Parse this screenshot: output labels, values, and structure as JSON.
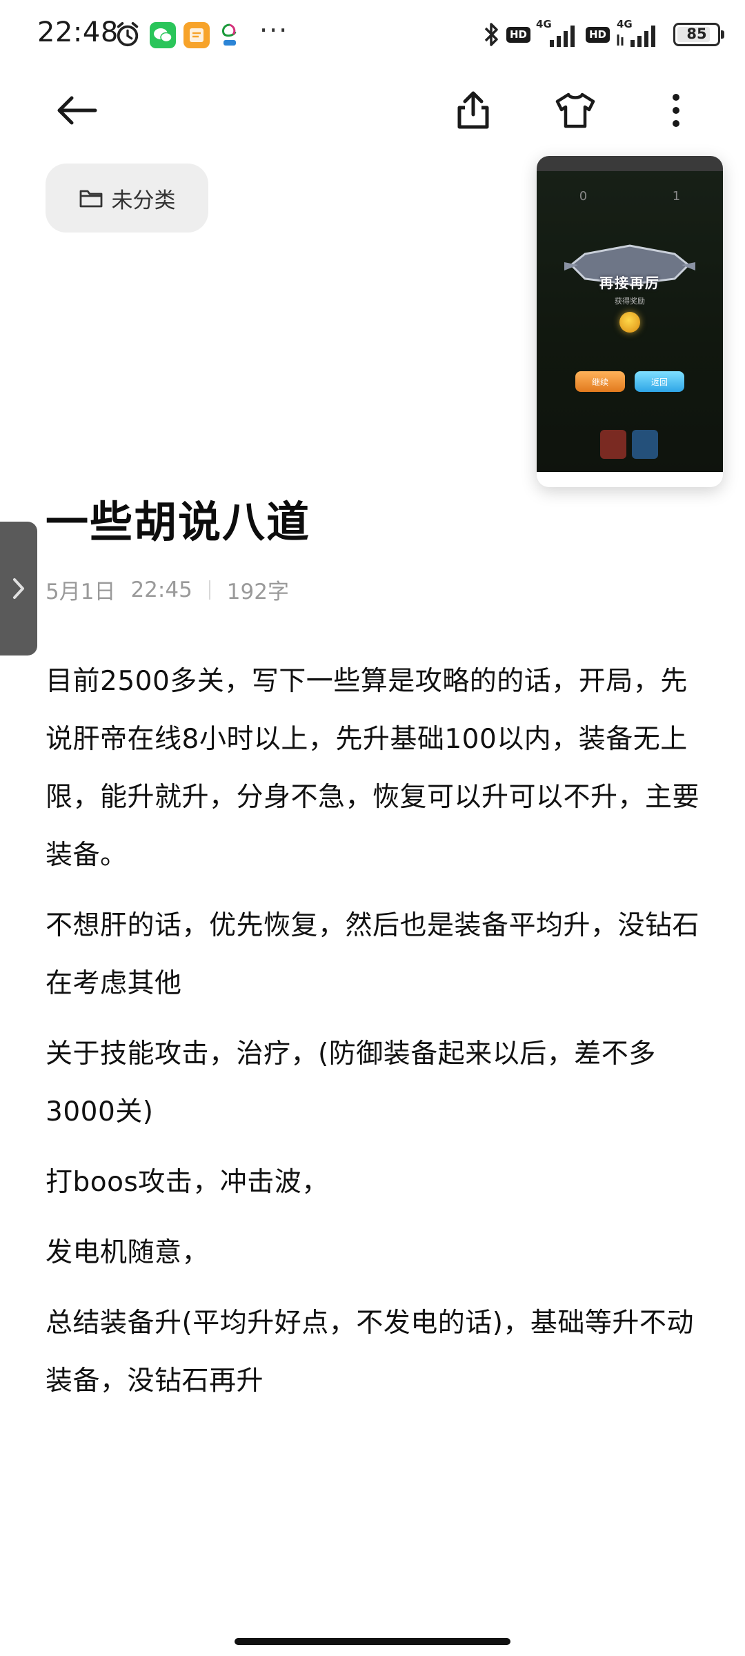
{
  "status_bar": {
    "time": "22:48",
    "more": "···",
    "network_label_1": "4G",
    "network_label_2": "4G",
    "hd_label": "HD",
    "battery": "85",
    "battery_level": 0.85,
    "icons": [
      "alarm-icon",
      "wechat-icon",
      "notes-app-icon",
      "china-mobile-icon",
      "bluetooth-icon",
      "signal-icon",
      "battery-icon"
    ]
  },
  "toolbar": {
    "icons": [
      "back-arrow-icon",
      "share-icon",
      "shirt-theme-icon",
      "more-vert-icon"
    ]
  },
  "category": {
    "label": "未分类",
    "icon": "folder-icon"
  },
  "thumbnail": {
    "score_left": "0",
    "score_right": "1",
    "banner_text": "再接再厉",
    "reward_label": "获得奖励",
    "button_left": "继续",
    "button_right": "返回"
  },
  "note": {
    "title": "一些胡说八道",
    "date": "5月1日",
    "time": "22:45",
    "word_count": "192字",
    "paragraphs": [
      "目前2500多关，写下一些算是攻略的的话，开局，先说肝帝在线8小时以上，先升基础100以内，装备无上限，能升就升，分身不急，恢复可以升可以不升，主要装备。",
      "不想肝的话，优先恢复，然后也是装备平均升，没钻石在考虑其他",
      "关于技能攻击，治疗，(防御装备起来以后，差不多3000关)",
      "打boos攻击，冲击波，",
      "发电机随意，",
      "总结装备升(平均升好点，不发电的话)，基础等升不动装备，没钻石再升"
    ]
  },
  "colors": {
    "background": "#ffffff",
    "chip_bg": "#eeeeee",
    "meta_text": "#9a9a9a",
    "side_handle": "#5a5a5a"
  }
}
